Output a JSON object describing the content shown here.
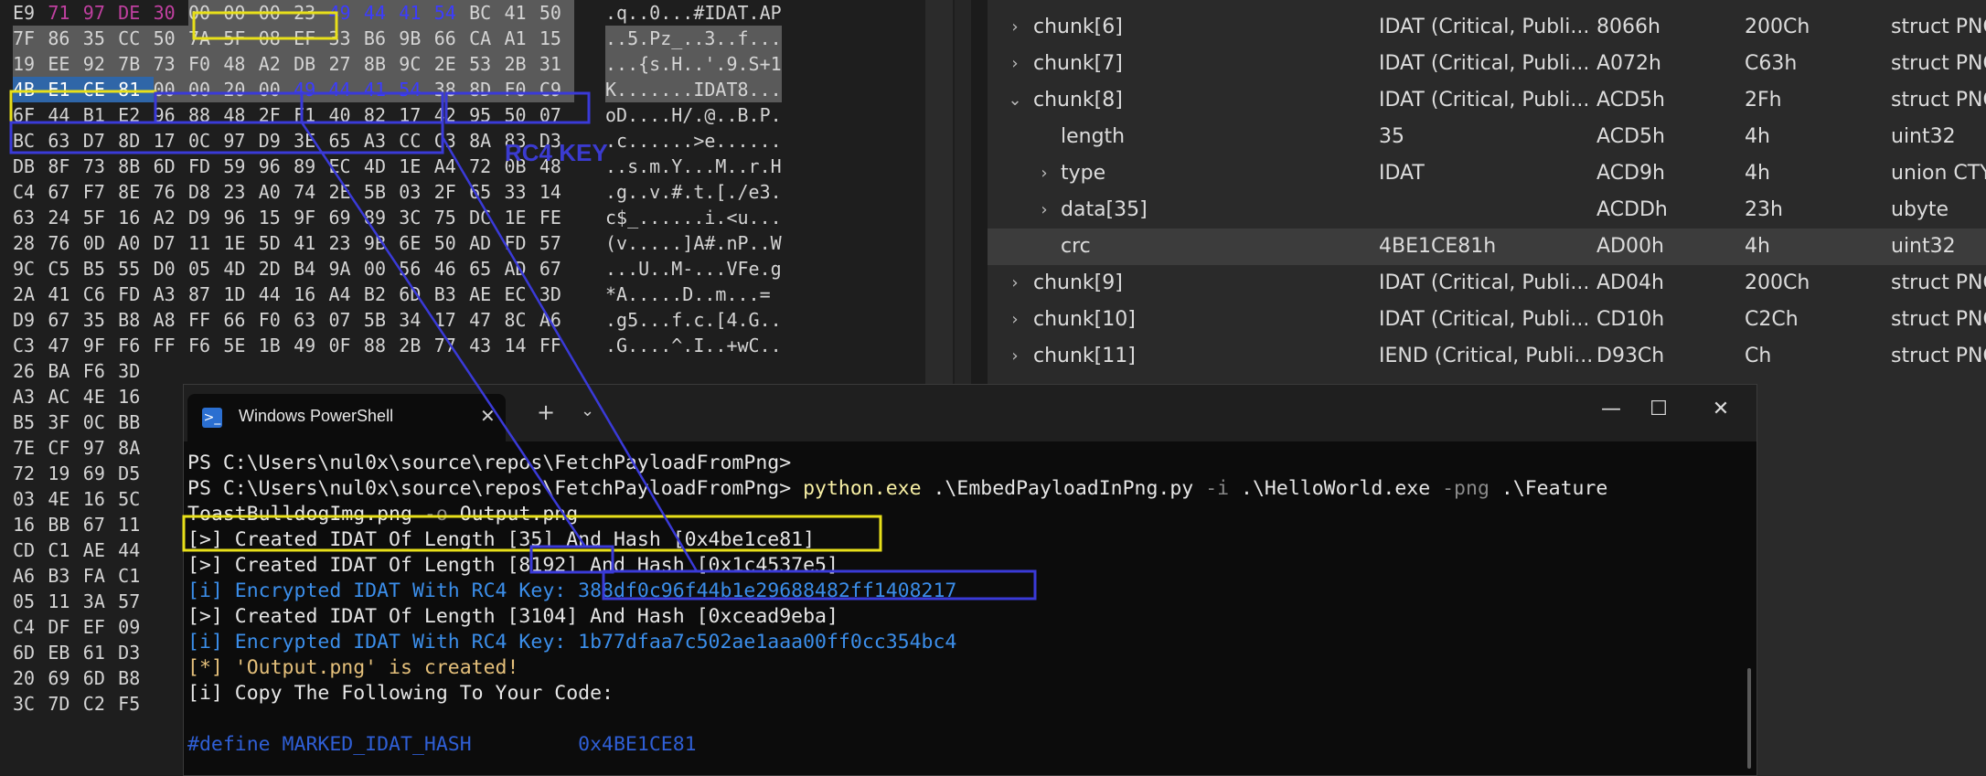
{
  "hex": {
    "rows": [
      [
        "E9",
        "71",
        "97",
        "DE",
        "30",
        "00",
        "00",
        "00",
        "23",
        "49",
        "44",
        "41",
        "54",
        "BC",
        "41",
        "50"
      ],
      [
        "7F",
        "86",
        "35",
        "CC",
        "50",
        "7A",
        "5F",
        "08",
        "EF",
        "33",
        "B6",
        "9B",
        "66",
        "CA",
        "A1",
        "15"
      ],
      [
        "19",
        "EE",
        "92",
        "7B",
        "73",
        "F0",
        "48",
        "A2",
        "DB",
        "27",
        "8B",
        "9C",
        "2E",
        "53",
        "2B",
        "31"
      ],
      [
        "4B",
        "E1",
        "CE",
        "81",
        "00",
        "00",
        "20",
        "00",
        "49",
        "44",
        "41",
        "54",
        "38",
        "8D",
        "F0",
        "C9"
      ],
      [
        "6F",
        "44",
        "B1",
        "E2",
        "96",
        "88",
        "48",
        "2F",
        "F1",
        "40",
        "82",
        "17",
        "42",
        "95",
        "50",
        "07"
      ],
      [
        "BC",
        "63",
        "D7",
        "8D",
        "17",
        "0C",
        "97",
        "D9",
        "3E",
        "65",
        "A3",
        "CC",
        "C3",
        "8A",
        "83",
        "D3"
      ],
      [
        "DB",
        "8F",
        "73",
        "8B",
        "6D",
        "FD",
        "59",
        "96",
        "89",
        "EC",
        "4D",
        "1E",
        "A4",
        "72",
        "0B",
        "48"
      ],
      [
        "C4",
        "67",
        "F7",
        "8E",
        "76",
        "D8",
        "23",
        "A0",
        "74",
        "2E",
        "5B",
        "03",
        "2F",
        "65",
        "33",
        "14"
      ],
      [
        "63",
        "24",
        "5F",
        "16",
        "A2",
        "D9",
        "96",
        "15",
        "9F",
        "69",
        "89",
        "3C",
        "75",
        "DC",
        "1E",
        "FE"
      ],
      [
        "28",
        "76",
        "0D",
        "A0",
        "D7",
        "11",
        "1E",
        "5D",
        "41",
        "23",
        "9B",
        "6E",
        "50",
        "AD",
        "FD",
        "57"
      ],
      [
        "9C",
        "C5",
        "B5",
        "55",
        "D0",
        "05",
        "4D",
        "2D",
        "B4",
        "9A",
        "00",
        "56",
        "46",
        "65",
        "AD",
        "67"
      ],
      [
        "2A",
        "41",
        "C6",
        "FD",
        "A3",
        "87",
        "1D",
        "44",
        "16",
        "A4",
        "B2",
        "6D",
        "B3",
        "AE",
        "EC",
        "3D"
      ],
      [
        "D9",
        "67",
        "35",
        "B8",
        "A8",
        "FF",
        "66",
        "F0",
        "63",
        "07",
        "5B",
        "34",
        "17",
        "47",
        "8C",
        "A6"
      ],
      [
        "C3",
        "47",
        "9F",
        "F6",
        "FF",
        "F6",
        "5E",
        "1B",
        "49",
        "0F",
        "88",
        "2B",
        "77",
        "43",
        "14",
        "FF"
      ]
    ],
    "left_only_rows": [
      "26 BA F6 3D",
      "A3 AC 4E 16",
      "B5 3F 0C BB",
      "7E CF 97 8A",
      "72 19 69 D5",
      "03 4E 16 5C",
      "16 BB 67 11",
      "CD C1 AE 44",
      "A6 B3 FA C1",
      "05 11 3A 57",
      "C4 DF EF 09",
      "6D EB 61 D3",
      "20 69 6D B8",
      "3C 7D C2 F5"
    ],
    "ascii": [
      ".q..0...#IDAT.AP",
      "..5.Pz_..3..f...",
      "...{s.H..'.9.S+1",
      "K.......IDAT8...",
      "oD....H/.@..B.P.",
      ".c......>e......",
      "..s.m.Y...M..r.H",
      ".g..v.#.t.[./e3.",
      "c$_......i.<u...",
      "(v.....]A#.nP..W",
      "...U..M-...VFe.g",
      "*A.....D..m...=",
      ".g5...f.c.[4.G..",
      ".G....^.I..+wC.."
    ],
    "rc4_key_label": "RC4 KEY"
  },
  "tree": {
    "rows": [
      {
        "expander": "chevron-right",
        "indent": 0,
        "name": "chunk[6]",
        "value": "IDAT  (Critical, Publi...",
        "start": "8066h",
        "size": "200Ch",
        "type": "struct PNG"
      },
      {
        "expander": "chevron-right",
        "indent": 0,
        "name": "chunk[7]",
        "value": "IDAT  (Critical, Publi...",
        "start": "A072h",
        "size": "C63h",
        "type": "struct PNG"
      },
      {
        "expander": "chevron-down",
        "indent": 0,
        "name": "chunk[8]",
        "value": "IDAT  (Critical, Publi...",
        "start": "ACD5h",
        "size": "2Fh",
        "type": "struct PNG"
      },
      {
        "expander": "",
        "indent": 1,
        "name": "length",
        "value": "35",
        "start": "ACD5h",
        "size": "4h",
        "type": "uint32"
      },
      {
        "expander": "chevron-right",
        "indent": 1,
        "name": "type",
        "value": "IDAT",
        "start": "ACD9h",
        "size": "4h",
        "type": "union CTY"
      },
      {
        "expander": "chevron-right",
        "indent": 1,
        "name": "data[35]",
        "value": "",
        "start": "ACDDh",
        "size": "23h",
        "type": "ubyte"
      },
      {
        "expander": "",
        "indent": 1,
        "name": "crc",
        "value": "4BE1CE81h",
        "start": "AD00h",
        "size": "4h",
        "type": "uint32",
        "selected": true
      },
      {
        "expander": "chevron-right",
        "indent": 0,
        "name": "chunk[9]",
        "value": "IDAT  (Critical, Publi...",
        "start": "AD04h",
        "size": "200Ch",
        "type": "struct PNG"
      },
      {
        "expander": "chevron-right",
        "indent": 0,
        "name": "chunk[10]",
        "value": "IDAT  (Critical, Publi...",
        "start": "CD10h",
        "size": "C2Ch",
        "type": "struct PNG"
      },
      {
        "expander": "chevron-right",
        "indent": 0,
        "name": "chunk[11]",
        "value": "IEND  (Critical, Publi...",
        "start": "D93Ch",
        "size": "Ch",
        "type": "struct PNG"
      }
    ]
  },
  "powershell": {
    "tab_title": "Windows PowerShell",
    "tab_icon_glyph": ">_",
    "window_buttons": {
      "minimize": "—",
      "maximize": "☐",
      "close": "✕"
    },
    "lines": [
      [
        {
          "t": "PS C:\\Users\\nul0x\\source\\repos\\FetchPayloadFromPng> ",
          "c": "c-white"
        }
      ],
      [
        {
          "t": "PS C:\\Users\\nul0x\\source\\repos\\FetchPayloadFromPng> ",
          "c": "c-white"
        },
        {
          "t": "python.exe ",
          "c": "c-yellow"
        },
        {
          "t": ".\\EmbedPayloadInPng.py ",
          "c": "c-white"
        },
        {
          "t": "-i ",
          "c": "c-grey"
        },
        {
          "t": ".\\HelloWorld.exe ",
          "c": "c-white"
        },
        {
          "t": "-png ",
          "c": "c-grey"
        },
        {
          "t": ".\\Feature",
          "c": "c-white"
        }
      ],
      [
        {
          "t": "ToastBulldogImg.png ",
          "c": "c-white"
        },
        {
          "t": "-o ",
          "c": "c-grey"
        },
        {
          "t": "Output.png",
          "c": "c-white"
        }
      ],
      [
        {
          "t": "[>] Created IDAT Of Length [35] And Hash [0x4be1ce81]",
          "c": "c-white"
        }
      ],
      [
        {
          "t": "[>] Created IDAT Of Length [8192] And Hash [0x1c4537e5]",
          "c": "c-white"
        }
      ],
      [
        {
          "t": "[i] Encrypted IDAT With RC4 Key: 388df0c96f44b1e29688482ff1408217",
          "c": "c-blue"
        }
      ],
      [
        {
          "t": "[>] Created IDAT Of Length [3104] And Hash [0xcead9eba]",
          "c": "c-white"
        }
      ],
      [
        {
          "t": "[i] Encrypted IDAT With RC4 Key: 1b77dfaa7c502ae1aaa00ff0cc354bc4",
          "c": "c-blue"
        }
      ],
      [
        {
          "t": "[*] 'Output.png' is created!",
          "c": "c-gold"
        }
      ],
      [
        {
          "t": "[i] Copy The Following To Your Code:",
          "c": "c-white"
        }
      ],
      [
        {
          "t": "",
          "c": "c-white"
        }
      ],
      [
        {
          "t": "#define MARKED_IDAT_HASH         0x4BE1CE81",
          "c": "c-dkblue"
        }
      ]
    ]
  },
  "colors": {
    "annotation_yellow": "#e8e01a",
    "annotation_blue": "#3a3ad8",
    "rc4_label_blue": "#3b3bd0"
  }
}
